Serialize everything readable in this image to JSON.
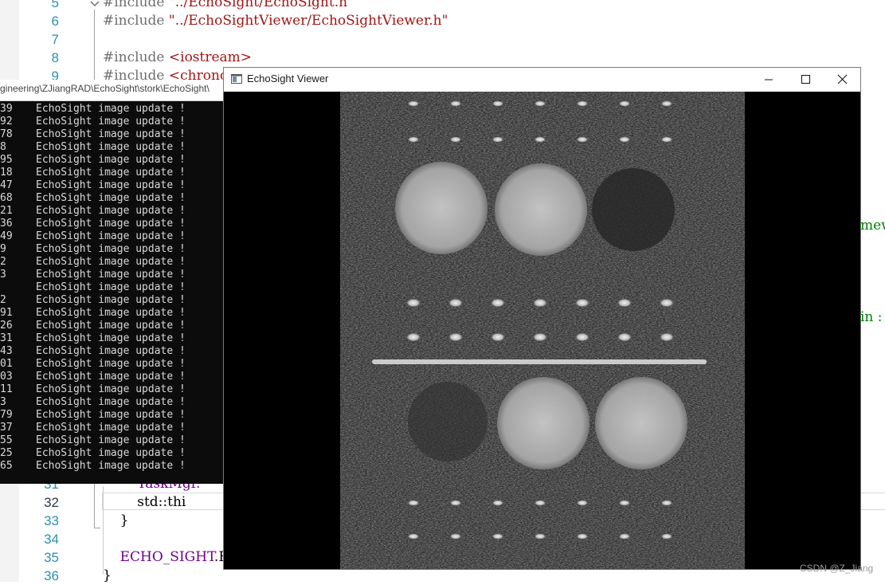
{
  "editor": {
    "lines": [
      {
        "no": "5",
        "parts": [
          {
            "t": "#include ",
            "c": "c-pre"
          },
          {
            "t": "\"../EchoSight/EchoSight.h\"",
            "c": "c-str"
          }
        ]
      },
      {
        "no": "6",
        "parts": [
          {
            "t": "#include ",
            "c": "c-pre"
          },
          {
            "t": "\"../EchoSightViewer/EchoSightViewer.h\"",
            "c": "c-str"
          }
        ]
      },
      {
        "no": "7",
        "parts": []
      },
      {
        "no": "8",
        "parts": [
          {
            "t": "#include ",
            "c": "c-pre"
          },
          {
            "t": "<iostream>",
            "c": "c-str"
          }
        ]
      },
      {
        "no": "9",
        "parts": [
          {
            "t": "#include ",
            "c": "c-pre"
          },
          {
            "t": "<chrono>",
            "c": "c-str"
          }
        ]
      },
      {
        "no": "31",
        "parts": [
          {
            "t": "        ",
            "c": "c-plain"
          },
          {
            "t": "TaskMgr.",
            "c": "c-macro"
          }
        ]
      },
      {
        "no": "32",
        "parts": [
          {
            "t": "        std::thi",
            "c": "c-plain"
          }
        ],
        "current": true
      },
      {
        "no": "33",
        "parts": [
          {
            "t": "    }",
            "c": "c-plain"
          }
        ]
      },
      {
        "no": "34",
        "parts": []
      },
      {
        "no": "35",
        "parts": [
          {
            "t": "    ",
            "c": "c-plain"
          },
          {
            "t": "ECHO_SIGHT",
            "c": "c-macro"
          },
          {
            "t": ".E",
            "c": "c-plain"
          }
        ]
      },
      {
        "no": "36",
        "parts": [
          {
            "t": "}",
            "c": "c-plain"
          }
        ]
      }
    ],
    "right_snippets": [
      "mewo",
      "in :"
    ]
  },
  "console": {
    "path": "gineering\\ZJiangRAD\\EchoSight\\stork\\EchoSight\\",
    "lines": [
      {
        "num": "39",
        "msg": "EchoSight image update !"
      },
      {
        "num": "92",
        "msg": "EchoSight image update !"
      },
      {
        "num": "78",
        "msg": "EchoSight image update !"
      },
      {
        "num": "8",
        "msg": "EchoSight image update !"
      },
      {
        "num": "95",
        "msg": "EchoSight image update !"
      },
      {
        "num": "18",
        "msg": "EchoSight image update !"
      },
      {
        "num": "47",
        "msg": "EchoSight image update !"
      },
      {
        "num": "68",
        "msg": "EchoSight image update !"
      },
      {
        "num": "21",
        "msg": "EchoSight image update !"
      },
      {
        "num": "36",
        "msg": "EchoSight image update !"
      },
      {
        "num": "49",
        "msg": "EchoSight image update !"
      },
      {
        "num": "9",
        "msg": "EchoSight image update !"
      },
      {
        "num": "2",
        "msg": "EchoSight image update !"
      },
      {
        "num": "3",
        "msg": "EchoSight image update !"
      },
      {
        "num": "",
        "msg": "EchoSight image update !"
      },
      {
        "num": "2",
        "msg": "EchoSight image update !"
      },
      {
        "num": "91",
        "msg": "EchoSight image update !"
      },
      {
        "num": "26",
        "msg": "EchoSight image update !"
      },
      {
        "num": "31",
        "msg": "EchoSight image update !"
      },
      {
        "num": "43",
        "msg": "EchoSight image update !"
      },
      {
        "num": "01",
        "msg": "EchoSight image update !"
      },
      {
        "num": "03",
        "msg": "EchoSight image update !"
      },
      {
        "num": "11",
        "msg": "EchoSight image update !"
      },
      {
        "num": "3",
        "msg": "EchoSight image update !"
      },
      {
        "num": "79",
        "msg": "EchoSight image update !"
      },
      {
        "num": "37",
        "msg": "EchoSight image update !"
      },
      {
        "num": "55",
        "msg": "EchoSight image update !"
      },
      {
        "num": "25",
        "msg": "EchoSight image update !"
      },
      {
        "num": "65",
        "msg": "EchoSight image update !"
      }
    ]
  },
  "viewer": {
    "title": "EchoSight Viewer",
    "buttons": {
      "minimize": "minimize-icon",
      "maximize": "maximize-icon",
      "close": "close-icon"
    }
  },
  "watermark": "CSDN @Z_Jiang",
  "colors": {
    "line_number": "#2b91af",
    "string": "#a31515",
    "macro": "#6f008a",
    "console_bg": "#0c0c0c",
    "console_text": "#d9d9d9"
  }
}
